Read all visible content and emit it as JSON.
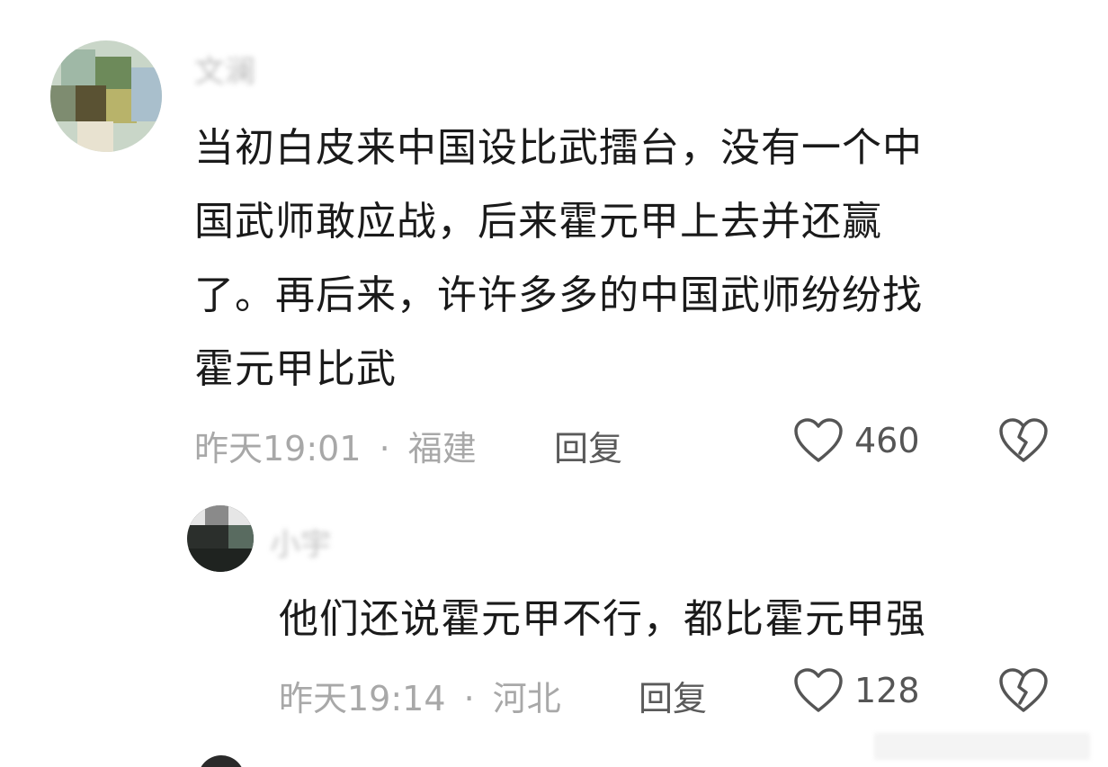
{
  "comments": [
    {
      "username": "文澜",
      "text_lines": [
        "当初白皮来中国设比武擂台，没有一个中",
        "国武师敢应战，后来霍元甲上去并还赢",
        "了。再后来，许许多多的中国武师纷纷找",
        "霍元甲比武"
      ],
      "time": "昨天19:01",
      "separator": "·",
      "location": "福建",
      "reply_label": "回复",
      "likes": "460",
      "like_icon": "heart-outline-icon",
      "dislike_icon": "broken-heart-icon"
    },
    {
      "username": "小宇",
      "text_lines": [
        "他们还说霍元甲不行，都比霍元甲强"
      ],
      "time": "昨天19:14",
      "separator": "·",
      "location": "河北",
      "reply_label": "回复",
      "likes": "128",
      "like_icon": "heart-outline-icon",
      "dislike_icon": "broken-heart-icon"
    }
  ],
  "colors": {
    "text": "#1a1a1a",
    "meta": "#a8a8a8",
    "icon": "#555555"
  }
}
